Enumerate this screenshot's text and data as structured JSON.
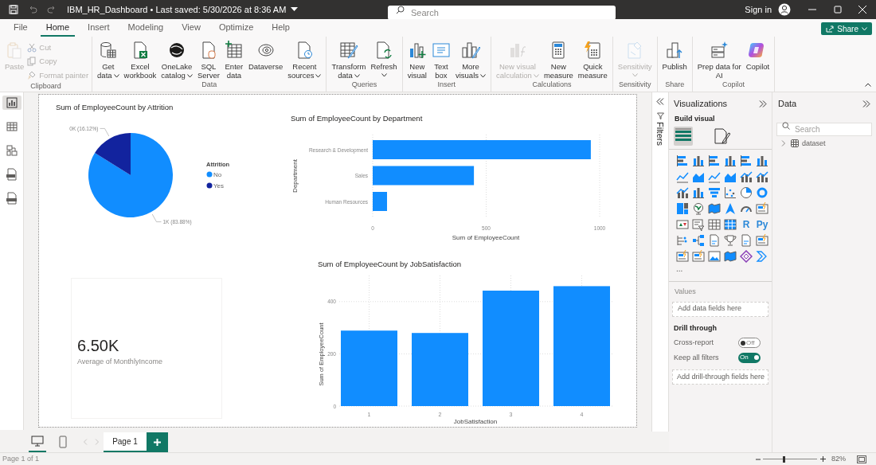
{
  "title_bar": {
    "document_title": "IBM_HR_Dashboard • Last saved: 5/30/2026 at 8:36 AM",
    "search": {
      "placeholder": "Search"
    },
    "sign_in": "Sign in"
  },
  "menu_tabs": [
    {
      "label": "File",
      "selected": false
    },
    {
      "label": "Home",
      "selected": true
    },
    {
      "label": "Insert",
      "selected": false
    },
    {
      "label": "Modeling",
      "selected": false
    },
    {
      "label": "View",
      "selected": false
    },
    {
      "label": "Optimize",
      "selected": false
    },
    {
      "label": "Help",
      "selected": false
    }
  ],
  "share_button": "Share",
  "ribbon_groups": [
    {
      "label": "Clipboard",
      "buttons": [
        {
          "label": "Paste",
          "kind": "large",
          "disabled": true,
          "caret": false
        },
        {
          "label": "Cut",
          "kind": "small",
          "disabled": true
        },
        {
          "label": "Copy",
          "kind": "small",
          "disabled": true
        },
        {
          "label": "Format painter",
          "kind": "small",
          "disabled": true
        }
      ]
    },
    {
      "label": "Data",
      "buttons": [
        {
          "label": "Get\ndata",
          "kind": "large",
          "disabled": false,
          "caret": true
        },
        {
          "label": "Excel\nworkbook",
          "kind": "large",
          "disabled": false,
          "caret": false
        },
        {
          "label": "OneLake\ncatalog",
          "kind": "large",
          "disabled": false,
          "caret": true
        },
        {
          "label": "SQL\nServer",
          "kind": "large",
          "disabled": false,
          "caret": false
        },
        {
          "label": "Enter\ndata",
          "kind": "large",
          "disabled": false,
          "caret": false
        },
        {
          "label": "Dataverse",
          "kind": "large",
          "disabled": false,
          "caret": false
        },
        {
          "label": "Recent\nsources",
          "kind": "large",
          "disabled": false,
          "caret": true
        }
      ]
    },
    {
      "label": "Queries",
      "buttons": [
        {
          "label": "Transform\ndata",
          "kind": "large",
          "disabled": false,
          "caret": true
        },
        {
          "label": "Refresh",
          "kind": "large",
          "disabled": false,
          "caret": true
        }
      ]
    },
    {
      "label": "Insert",
      "buttons": [
        {
          "label": "New\nvisual",
          "kind": "large",
          "disabled": false,
          "caret": false
        },
        {
          "label": "Text\nbox",
          "kind": "large",
          "disabled": false,
          "caret": false
        },
        {
          "label": "More\nvisuals",
          "kind": "large",
          "disabled": false,
          "caret": true
        }
      ]
    },
    {
      "label": "Calculations",
      "buttons": [
        {
          "label": "New visual\ncalculation",
          "kind": "large",
          "disabled": true,
          "caret": true
        },
        {
          "label": "New\nmeasure",
          "kind": "large",
          "disabled": false,
          "caret": false
        },
        {
          "label": "Quick\nmeasure",
          "kind": "large",
          "disabled": false,
          "caret": false
        }
      ]
    },
    {
      "label": "Sensitivity",
      "buttons": [
        {
          "label": "Sensitivity",
          "kind": "large",
          "disabled": true,
          "caret": true
        }
      ]
    },
    {
      "label": "Share",
      "buttons": [
        {
          "label": "Publish",
          "kind": "large",
          "disabled": false,
          "caret": false
        }
      ]
    },
    {
      "label": "Copilot",
      "buttons": [
        {
          "label": "Prep data for\nAI",
          "kind": "large",
          "disabled": false,
          "caret": false
        },
        {
          "label": "Copilot",
          "kind": "large",
          "disabled": false,
          "caret": false
        }
      ]
    }
  ],
  "left_nav": [
    {
      "selected": true
    },
    {
      "selected": false
    },
    {
      "selected": false
    },
    {
      "selected": false
    },
    {
      "selected": false
    }
  ],
  "visuals": [
    {
      "legend_title": "Attrition",
      "slice_colors": [
        {
          "color": "#118dff"
        },
        {
          "color": "#12239e"
        }
      ],
      "chart_data": {
        "type": "pie",
        "title": "Sum of EmployeeCount by Attrition",
        "categories": [
          "No",
          "Yes"
        ],
        "values": [
          83.88,
          16.12
        ],
        "legend": "right",
        "data_labels": true,
        "value_labels": [
          "1K (83.88%)",
          "0K (16.12%)"
        ]
      }
    },
    {
      "color": "#118dff",
      "chart_data": {
        "type": "bar",
        "orientation": "horizontal",
        "title": "Sum of EmployeeCount by Department",
        "xlabel": "Sum of EmployeeCount",
        "ylabel": "Department",
        "categories": [
          "Research & Development",
          "Sales",
          "Human Resources"
        ],
        "values": [
          961,
          446,
          63
        ],
        "xticks": [
          0,
          500,
          1000
        ],
        "xlim": [
          0,
          1000
        ],
        "grid": true
      }
    },
    {
      "color": "#118dff",
      "chart_data": {
        "type": "bar",
        "orientation": "vertical",
        "title": "Sum of EmployeeCount by JobSatisfaction",
        "xlabel": "JobSatisfaction",
        "ylabel": "Sum of EmployeeCount",
        "categories": [
          "1",
          "2",
          "3",
          "4"
        ],
        "values": [
          289,
          280,
          442,
          459
        ],
        "yticks": [
          0,
          200,
          400
        ],
        "ylim": [
          0,
          500
        ],
        "grid": true
      }
    },
    {
      "kind": "card",
      "value": "6.50K",
      "label": "Average of MonthlyIncome"
    }
  ],
  "filters_pane": {
    "label": "Filters"
  },
  "visualizations_pane": {
    "title": "Visualizations",
    "build_visual_label": "Build visual",
    "build_tabs": [
      {
        "selected": true
      },
      {
        "selected": false
      }
    ],
    "script_visuals": [
      {
        "glyph": "R"
      },
      {
        "glyph": "Py"
      }
    ],
    "more": "...",
    "values_label": "Values",
    "values_well": "Add data fields here",
    "drill_through": {
      "title": "Drill through",
      "toggles": [
        {
          "label": "Cross-report",
          "on": false,
          "state_text": "Off"
        },
        {
          "label": "Keep all filters",
          "on": true,
          "state_text": "On"
        }
      ],
      "well": "Add drill-through fields here"
    }
  },
  "data_pane": {
    "title": "Data",
    "search": {
      "placeholder": "Search"
    },
    "tree": [
      {
        "label": "dataset",
        "expanded": false
      }
    ]
  },
  "page_tabs": {
    "views": [
      {
        "selected": true
      },
      {
        "selected": false
      }
    ],
    "pages": [
      {
        "label": "Page 1",
        "selected": true
      }
    ]
  },
  "status_bar": {
    "page_info": "Page 1 of 1",
    "zoom": {
      "level": 0.38,
      "reading": "82%"
    }
  }
}
